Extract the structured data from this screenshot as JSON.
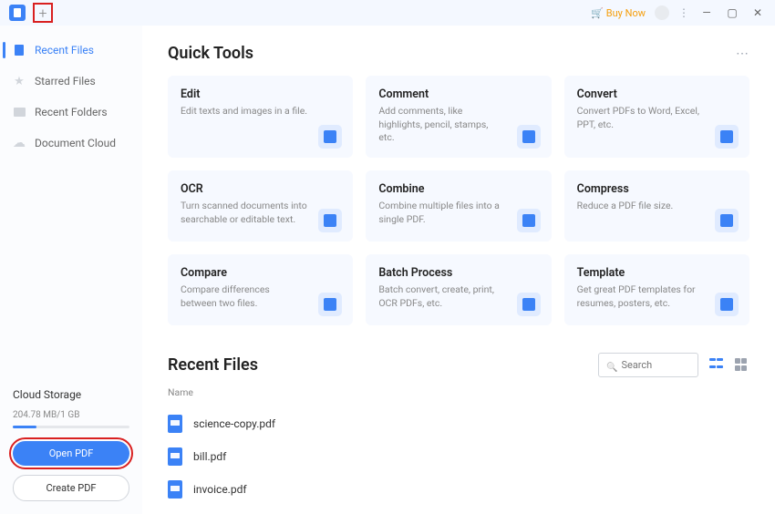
{
  "titlebar": {
    "buy_now": "Buy Now"
  },
  "sidebar": {
    "items": [
      {
        "label": "Recent Files"
      },
      {
        "label": "Starred Files"
      },
      {
        "label": "Recent Folders"
      },
      {
        "label": "Document Cloud"
      }
    ]
  },
  "cloud": {
    "title": "Cloud Storage",
    "usage": "204.78 MB/1 GB",
    "open_label": "Open PDF",
    "create_label": "Create PDF"
  },
  "quick_tools": {
    "title": "Quick Tools",
    "cards": [
      {
        "title": "Edit",
        "desc": "Edit texts and images in a file."
      },
      {
        "title": "Comment",
        "desc": "Add comments, like highlights, pencil, stamps, etc."
      },
      {
        "title": "Convert",
        "desc": "Convert PDFs to Word, Excel, PPT, etc."
      },
      {
        "title": "OCR",
        "desc": "Turn scanned documents into searchable or editable text."
      },
      {
        "title": "Combine",
        "desc": "Combine multiple files into a single PDF."
      },
      {
        "title": "Compress",
        "desc": "Reduce a PDF file size."
      },
      {
        "title": "Compare",
        "desc": "Compare differences between two files."
      },
      {
        "title": "Batch Process",
        "desc": "Batch convert, create, print, OCR PDFs, etc."
      },
      {
        "title": "Template",
        "desc": "Get great PDF templates for resumes, posters, etc."
      }
    ]
  },
  "recent": {
    "title": "Recent Files",
    "search_placeholder": "Search",
    "col_name": "Name",
    "files": [
      {
        "name": "science-copy.pdf"
      },
      {
        "name": "bill.pdf"
      },
      {
        "name": "invoice.pdf"
      }
    ]
  }
}
